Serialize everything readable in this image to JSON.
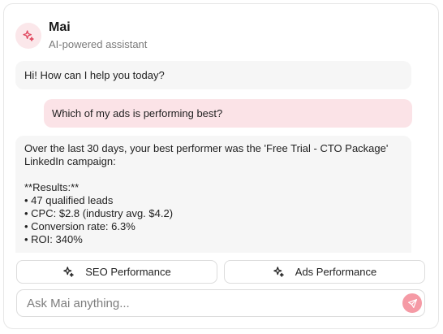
{
  "header": {
    "title": "Mai",
    "subtitle": "AI-powered assistant",
    "avatar_icon": "sparkle-icon"
  },
  "messages": [
    {
      "role": "assistant",
      "text": "Hi! How can I help you today?"
    },
    {
      "role": "user",
      "text": "Which of my ads is performing best?"
    },
    {
      "role": "assistant",
      "lines": [
        "Over the last 30 days, your best performer was the 'Free Trial - CTO Package'",
        "LinkedIn campaign:",
        "",
        "**Results:**",
        "• 47 qualified leads",
        "• CPC: $2.8 (industry avg. $4.2)",
        "• Conversion rate: 6.3%",
        "• ROI: 340%"
      ]
    }
  ],
  "quick_actions": [
    {
      "label": "SEO Performance",
      "icon": "sparkle-icon"
    },
    {
      "label": "Ads Performance",
      "icon": "sparkle-icon"
    }
  ],
  "composer": {
    "placeholder": "Ask Mai anything...",
    "value": "",
    "send_icon": "send-icon"
  },
  "colors": {
    "accent": "#e0485f",
    "avatar_bg": "#fbe7ea",
    "user_bubble": "#fbe3e7",
    "assistant_bubble": "#f6f6f6",
    "send_button": "#f59aa5"
  }
}
